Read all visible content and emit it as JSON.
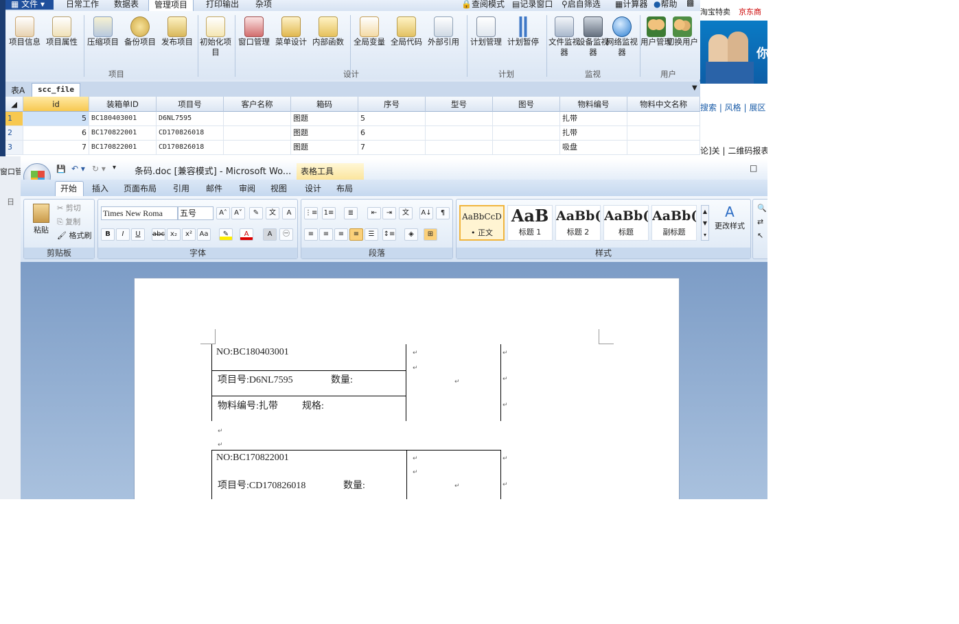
{
  "erp": {
    "file_menu": "文件",
    "menu_tabs": [
      "日常工作",
      "数据表",
      "管理项目",
      "打印输出",
      "杂项"
    ],
    "right_tools": [
      "查阅模式",
      "记录窗口",
      "启自筛选",
      "计算器",
      "帮助"
    ],
    "ribbon_buttons": [
      "项目信息",
      "项目属性",
      "压缩项目",
      "备份项目",
      "发布项目",
      "初始化项目",
      "窗口管理",
      "菜单设计",
      "内部函数",
      "全局变量",
      "全局代码",
      "外部引用",
      "计划管理",
      "计划暂停",
      "文件监视器",
      "设备监视器",
      "网络监视器",
      "用户管理",
      "切换用户"
    ],
    "groups": [
      "项目",
      "设计",
      "计划",
      "监视",
      "用户"
    ],
    "tabs": [
      "表A",
      "scc_file"
    ],
    "grid": {
      "columns": [
        "id",
        "装箱单ID",
        "项目号",
        "客户名称",
        "箱码",
        "序号",
        "型号",
        "图号",
        "物料编号",
        "物料中文名称"
      ],
      "rows": [
        {
          "num": "1",
          "id": "5",
          "box": "BC180403001",
          "proj": "D6NL7595",
          "cust": "",
          "code": "图题",
          "seq": "5",
          "model": "",
          "fig": "",
          "mat": "扎带",
          "name": ""
        },
        {
          "num": "2",
          "id": "6",
          "box": "BC170822001",
          "proj": "CD170826018",
          "cust": "",
          "code": "图题",
          "seq": "6",
          "model": "",
          "fig": "",
          "mat": "扎带",
          "name": ""
        },
        {
          "num": "3",
          "id": "7",
          "box": "BC170822001",
          "proj": "CD170826018",
          "cust": "",
          "code": "图题",
          "seq": "7",
          "model": "",
          "fig": "",
          "mat": "吸盘",
          "name": ""
        }
      ]
    }
  },
  "browser": {
    "bookmarks": [
      "淘宝特卖",
      "京东商"
    ],
    "banner_text": "你",
    "links1": "搜索 | 风格 | 展区",
    "links2": "论]关 | 二维码报表"
  },
  "word": {
    "title": "条码.doc [兼容模式] - Microsoft Wo...",
    "context_tab": "表格工具",
    "tabs": [
      "开始",
      "插入",
      "页面布局",
      "引用",
      "邮件",
      "审阅",
      "视图",
      "设计",
      "布局"
    ],
    "clipboard": {
      "paste": "粘贴",
      "cut": "剪切",
      "copy": "复制",
      "painter": "格式刷",
      "label": "剪贴板"
    },
    "font": {
      "name": "Times New Roma",
      "size": "五号",
      "label": "字体"
    },
    "paragraph_label": "段落",
    "styles": [
      {
        "preview": "AaBbCcD",
        "name": "• 正文"
      },
      {
        "preview": "AaB",
        "name": "标题 1"
      },
      {
        "preview": "AaBb(",
        "name": "标题 2"
      },
      {
        "preview": "AaBb(",
        "name": "标题"
      },
      {
        "preview": "AaBb(",
        "name": "副标题"
      }
    ],
    "styles_label": "样式",
    "change_styles": "更改样式",
    "doc": {
      "label1_no": "NO:BC180403001",
      "label1_proj": "项目号:D6NL7595",
      "label1_qty": "数量:",
      "label1_mat": "物料编号:扎带",
      "label1_spec": "规格:",
      "label2_no": "NO:BC170822001",
      "label2_proj": "项目号:CD170826018",
      "label2_qty": "数量:"
    }
  },
  "left_fragments": {
    "win": "窗口管",
    "day": "日"
  }
}
